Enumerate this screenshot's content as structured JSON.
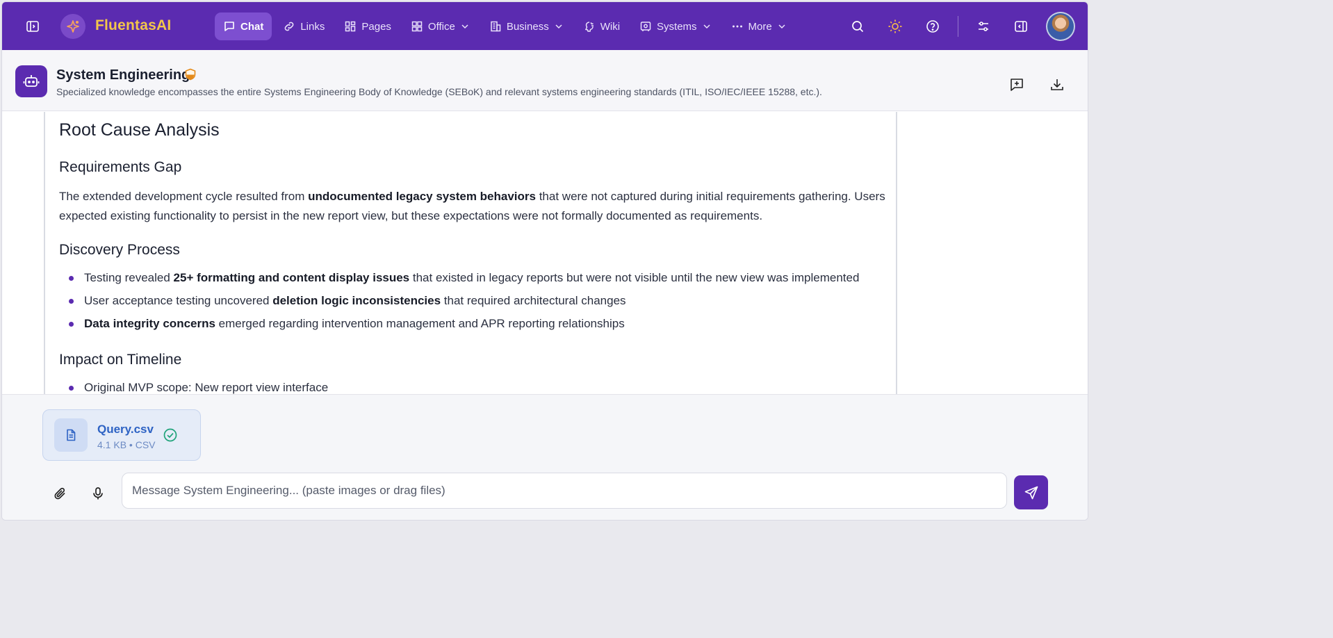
{
  "app": {
    "brand": "FluentasAI"
  },
  "nav": {
    "items": [
      {
        "label": "Chat",
        "icon": "chat-bubble-icon",
        "active": true,
        "dropdown": false
      },
      {
        "label": "Links",
        "icon": "link-icon",
        "active": false,
        "dropdown": false
      },
      {
        "label": "Pages",
        "icon": "grid-pages-icon",
        "active": false,
        "dropdown": false
      },
      {
        "label": "Office",
        "icon": "apps-grid-icon",
        "active": false,
        "dropdown": true
      },
      {
        "label": "Business",
        "icon": "building-icon",
        "active": false,
        "dropdown": true
      },
      {
        "label": "Wiki",
        "icon": "brain-icon",
        "active": false,
        "dropdown": false
      },
      {
        "label": "Systems",
        "icon": "systems-icon",
        "active": false,
        "dropdown": true
      },
      {
        "label": "More",
        "icon": "dots-icon",
        "active": false,
        "dropdown": true
      }
    ]
  },
  "assistant": {
    "name": "System Engineering",
    "description": "Specialized knowledge encompasses the entire Systems Engineering Body of Knowledge (SEBoK) and relevant systems engineering standards (ITIL, ISO/IEC/IEEE 15288, etc.)."
  },
  "message": {
    "heading": "Root Cause Analysis",
    "sections": [
      {
        "title": "Requirements Gap",
        "paragraph": {
          "pre": "The extended development cycle resulted from ",
          "bold": "undocumented legacy system behaviors",
          "post": " that were not captured during initial requirements gathering. Users expected existing functionality to persist in the new report view, but these expectations were not formally documented as requirements."
        }
      },
      {
        "title": "Discovery Process",
        "bullets": [
          {
            "pre": "Testing revealed ",
            "bold": "25+ formatting and content display issues",
            "post": " that existed in legacy reports but were not visible until the new view was implemented"
          },
          {
            "pre": "User acceptance testing uncovered ",
            "bold": "deletion logic inconsistencies",
            "post": " that required architectural changes"
          },
          {
            "pre": "",
            "bold": "Data integrity concerns",
            "post": " emerged regarding intervention management and APR reporting relationships"
          }
        ]
      },
      {
        "title": "Impact on Timeline",
        "bullets": [
          {
            "pre": "Original MVP scope: New report view interface",
            "bold": "",
            "post": ""
          }
        ]
      }
    ]
  },
  "attachment": {
    "name": "Query.csv",
    "meta": "4.1 KB • CSV",
    "status": "uploaded"
  },
  "composer": {
    "placeholder": "Message System Engineering... (paste images or drag files)",
    "value": ""
  },
  "colors": {
    "primary": "#5b2bb0",
    "brand_text": "#f3c64a",
    "link": "#2e63c4",
    "success": "#1fa37a"
  }
}
